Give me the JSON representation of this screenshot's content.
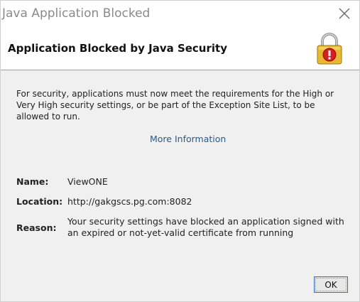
{
  "window": {
    "title": "Java Application Blocked",
    "close_icon": "close-icon"
  },
  "header": {
    "title": "Application Blocked by Java Security",
    "icon": "lock-warning-icon"
  },
  "message": "For security, applications must now meet the requirements for the High or Very High security settings, or be part of the Exception Site List, to be allowed to run.",
  "more_info_link": "More Information",
  "details": {
    "name_label": "Name:",
    "name_value": "ViewONE",
    "location_label": "Location:",
    "location_value": "http://gakgscs.pg.com:8082",
    "reason_label": "Reason:",
    "reason_value": "Your security settings have blocked an application signed with an expired or not-yet-valid certificate from running"
  },
  "buttons": {
    "ok_label": "OK"
  },
  "colors": {
    "link": "#2a5a8a",
    "lock_body": "#e8b830",
    "warning_badge": "#d42020",
    "button_border": "#2a6fc9"
  }
}
